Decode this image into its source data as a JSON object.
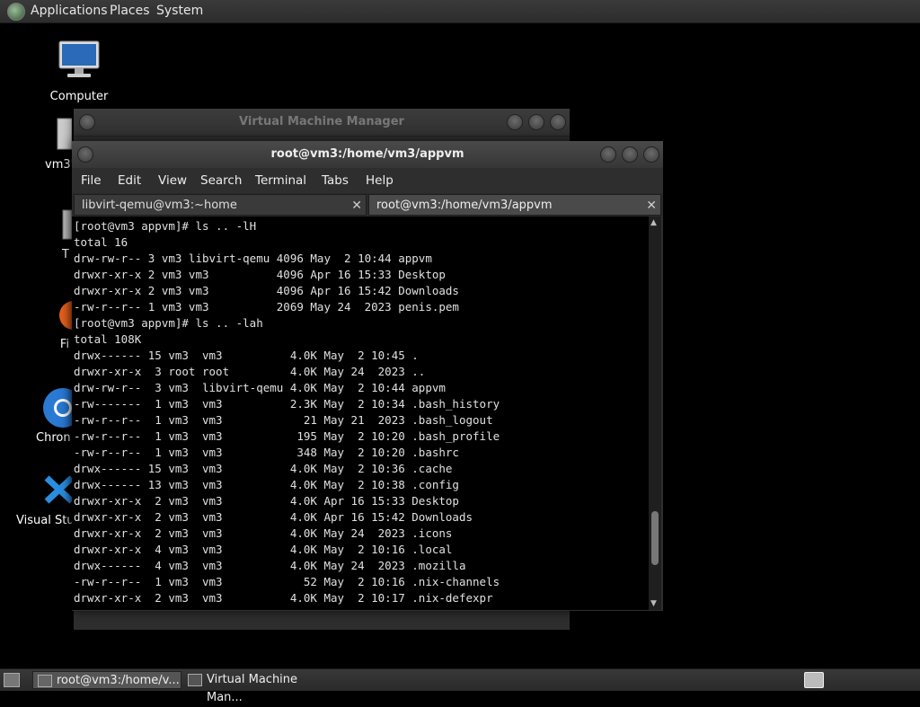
{
  "top_panel": {
    "menus": [
      "Applications",
      "Places",
      "System"
    ]
  },
  "desktop_icons": [
    {
      "label": "Computer"
    },
    {
      "label": "vm3'"
    },
    {
      "label": "T"
    },
    {
      "label": "Fi"
    },
    {
      "label": "Chron"
    },
    {
      "label": "Visual Stu"
    }
  ],
  "vmm_window": {
    "title": "Virtual Machine Manager"
  },
  "terminal_window": {
    "title": "root@vm3:/home/vm3/appvm",
    "menu": [
      "File",
      "Edit",
      "View",
      "Search",
      "Terminal",
      "Tabs",
      "Help"
    ],
    "tabs": [
      {
        "label": "libvirt-qemu@vm3:~home",
        "active": false
      },
      {
        "label": "root@vm3:/home/vm3/appvm",
        "active": true
      }
    ],
    "output": "[root@vm3 appvm]# ls .. -lH\ntotal 16\ndrw-rw-r-- 3 vm3 libvirt-qemu 4096 May  2 10:44 appvm\ndrwxr-xr-x 2 vm3 vm3          4096 Apr 16 15:33 Desktop\ndrwxr-xr-x 2 vm3 vm3          4096 Apr 16 15:42 Downloads\n-rw-r--r-- 1 vm3 vm3          2069 May 24  2023 penis.pem\n[root@vm3 appvm]# ls .. -lah\ntotal 108K\ndrwx------ 15 vm3  vm3          4.0K May  2 10:45 .\ndrwxr-xr-x  3 root root         4.0K May 24  2023 ..\ndrw-rw-r--  3 vm3  libvirt-qemu 4.0K May  2 10:44 appvm\n-rw-------  1 vm3  vm3          2.3K May  2 10:34 .bash_history\n-rw-r--r--  1 vm3  vm3            21 May 21  2023 .bash_logout\n-rw-r--r--  1 vm3  vm3           195 May  2 10:20 .bash_profile\n-rw-r--r--  1 vm3  vm3           348 May  2 10:20 .bashrc\ndrwx------ 15 vm3  vm3          4.0K May  2 10:36 .cache\ndrwx------ 13 vm3  vm3          4.0K May  2 10:38 .config\ndrwxr-xr-x  2 vm3  vm3          4.0K Apr 16 15:33 Desktop\ndrwxr-xr-x  2 vm3  vm3          4.0K Apr 16 15:42 Downloads\ndrwxr-xr-x  2 vm3  vm3          4.0K May 24  2023 .icons\ndrwxr-xr-x  4 vm3  vm3          4.0K May  2 10:16 .local\ndrwx------  4 vm3  vm3          4.0K May 24  2023 .mozilla\n-rw-r--r--  1 vm3  vm3            52 May  2 10:16 .nix-channels\ndrwxr-xr-x  2 vm3  vm3          4.0K May  2 10:17 .nix-defexpr"
  },
  "taskbar": {
    "tasks": [
      {
        "label": "root@vm3:/home/v...",
        "active": true
      },
      {
        "label": "Virtual Machine Man...",
        "active": false
      }
    ]
  }
}
